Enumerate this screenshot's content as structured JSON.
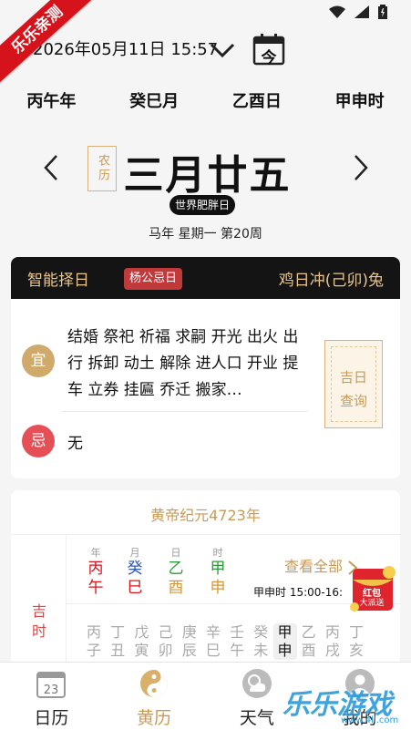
{
  "status": {
    "time": ""
  },
  "ribbon": "乐乐亲测",
  "header": {
    "datetime": "2026年05月11日 15:57",
    "today_label": "今",
    "ganzhi": [
      "丙午年",
      "癸巳月",
      "乙酉日",
      "甲申时"
    ]
  },
  "lunar": {
    "tag": "农历",
    "date": "三月廿五",
    "festival": "世界肥胖日",
    "week_info": "马年 星期一 第20周"
  },
  "toolbar": {
    "left": "智能择日",
    "badge": "杨公忌日",
    "right": "鸡日冲(己卯)兔"
  },
  "yiji": {
    "yi_label": "宜",
    "yi_text": "结婚 祭祀 祈福 求嗣 开光 出火 出行 拆卸 动土 解除 进人口 开业 提车 立券 挂匾 乔迁 搬家…",
    "ji_label": "忌",
    "ji_text": "无",
    "button_line1": "吉日",
    "button_line2": "查询"
  },
  "huangdi": {
    "title": "黄帝纪元4723年",
    "labels": [
      "年",
      "月",
      "日",
      "时"
    ],
    "pillars": [
      {
        "top": "丙",
        "bottom": "午",
        "color": "#d6121b"
      },
      {
        "top": "癸",
        "bottom": "巳",
        "color_top": "#2b58b8",
        "color": "#d6121b"
      },
      {
        "top": "乙",
        "bottom": "酉",
        "color_top": "#2e9a3a",
        "color": "#d8963a"
      },
      {
        "top": "甲",
        "bottom": "申",
        "color_top": "#2e9a3a",
        "color": "#d8963a"
      }
    ],
    "see_all": "查看全部",
    "hour_text": "甲申时 15:00-16:",
    "jishi": "吉时",
    "hours": [
      [
        "丙",
        "子"
      ],
      [
        "丁",
        "丑"
      ],
      [
        "戊",
        "寅"
      ],
      [
        "己",
        "卯"
      ],
      [
        "庚",
        "辰"
      ],
      [
        "辛",
        "巳"
      ],
      [
        "壬",
        "午"
      ],
      [
        "癸",
        "未"
      ],
      [
        "甲",
        "申"
      ],
      [
        "乙",
        "酉"
      ],
      [
        "丙",
        "戌"
      ],
      [
        "丁",
        "亥"
      ]
    ]
  },
  "nav": [
    {
      "label": "日历",
      "icon": "calendar-icon"
    },
    {
      "label": "黄历",
      "icon": "yin-yang-icon"
    },
    {
      "label": "天气",
      "icon": "weather-icon"
    },
    {
      "label": "我的",
      "icon": "user-icon"
    }
  ],
  "nav_calendar_day": "23",
  "hongbao": {
    "line1": "红包",
    "line2": "大派送"
  },
  "watermark": {
    "text": "乐乐游戏",
    "url": "www.4ll.com"
  }
}
